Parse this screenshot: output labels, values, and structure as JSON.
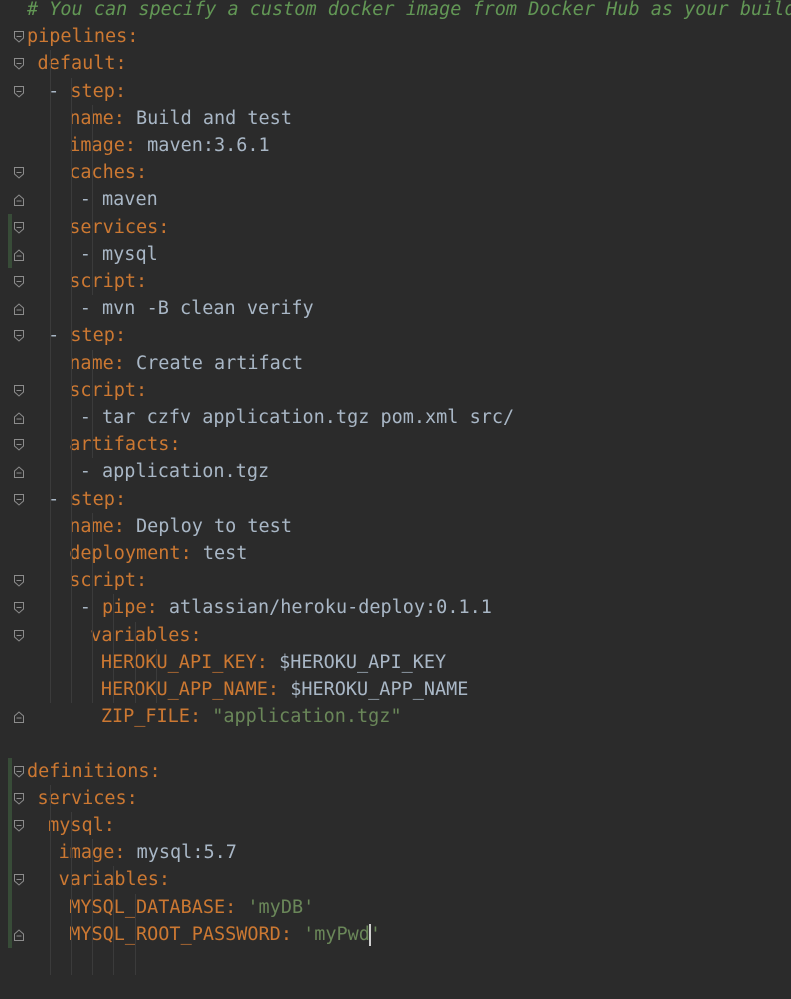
{
  "editor": {
    "language": "yaml",
    "colors": {
      "background": "#2b2b2b",
      "key": "#cc7832",
      "value": "#a9b7c6",
      "string": "#6a8759",
      "comment": "#629755",
      "change_marker": "#384c38"
    },
    "lines": [
      {
        "comment": "# You can specify a custom docker image from Docker Hub as your build environment."
      },
      {
        "key": "pipelines",
        "sep": ":"
      },
      {
        "key": "default",
        "sep": ":"
      },
      {
        "dash": "- ",
        "key": "step",
        "sep": ":"
      },
      {
        "key": "name",
        "sep": ": ",
        "value": "Build and test"
      },
      {
        "key": "image",
        "sep": ": ",
        "value": "maven:3.6.1"
      },
      {
        "key": "caches",
        "sep": ":"
      },
      {
        "dash": "- ",
        "value": "maven"
      },
      {
        "key": "services",
        "sep": ":"
      },
      {
        "dash": "- ",
        "value": "mysql"
      },
      {
        "key": "script",
        "sep": ":"
      },
      {
        "dash": "- ",
        "value": "mvn -B clean verify"
      },
      {
        "dash": "- ",
        "key": "step",
        "sep": ":"
      },
      {
        "key": "name",
        "sep": ": ",
        "value": "Create artifact"
      },
      {
        "key": "script",
        "sep": ":"
      },
      {
        "dash": "- ",
        "value": "tar czfv application.tgz pom.xml src/"
      },
      {
        "key": "artifacts",
        "sep": ":"
      },
      {
        "dash": "- ",
        "value": "application.tgz"
      },
      {
        "dash": "- ",
        "key": "step",
        "sep": ":"
      },
      {
        "key": "name",
        "sep": ": ",
        "value": "Deploy to test"
      },
      {
        "key": "deployment",
        "sep": ": ",
        "value": "test"
      },
      {
        "key": "script",
        "sep": ":"
      },
      {
        "dash": "- ",
        "key": "pipe",
        "sep": ": ",
        "value": "atlassian/heroku-deploy:0.1.1"
      },
      {
        "key": "variables",
        "sep": ":"
      },
      {
        "key": "HEROKU_API_KEY",
        "sep": ": ",
        "value": "$HEROKU_API_KEY"
      },
      {
        "key": "HEROKU_APP_NAME",
        "sep": ": ",
        "value": "$HEROKU_APP_NAME"
      },
      {
        "key": "ZIP_FILE",
        "sep": ": ",
        "string": "\"application.tgz\""
      },
      {},
      {
        "key": "definitions",
        "sep": ":"
      },
      {
        "key": "services",
        "sep": ":"
      },
      {
        "key": "mysql",
        "sep": ":"
      },
      {
        "key": "image",
        "sep": ": ",
        "value": "mysql:5.7"
      },
      {
        "key": "variables",
        "sep": ":"
      },
      {
        "key": "MYSQL_DATABASE",
        "sep": ": ",
        "string": "'myDB'"
      },
      {
        "key": "MYSQL_ROOT_PASSWORD",
        "sep": ": ",
        "string": "'myPwd'"
      }
    ]
  }
}
